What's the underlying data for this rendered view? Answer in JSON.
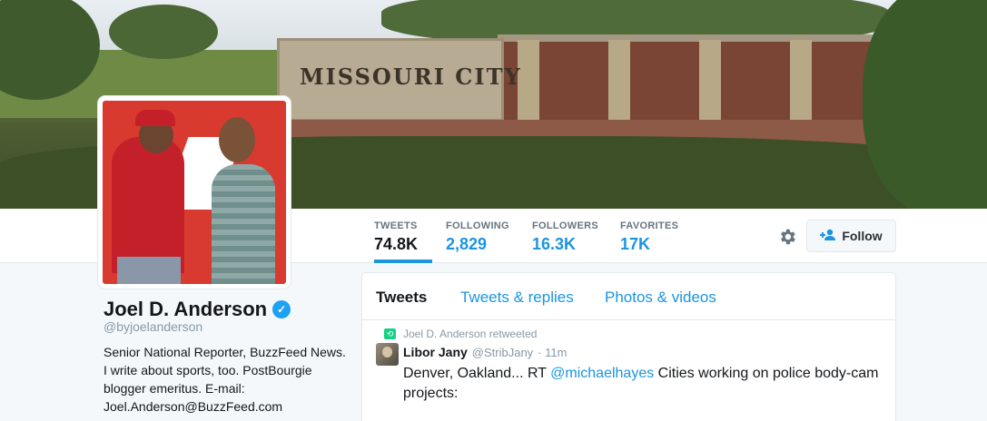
{
  "banner": {
    "sign_text": "MISSOURI CITY"
  },
  "nav": {
    "stats": [
      {
        "label": "TWEETS",
        "value": "74.8K"
      },
      {
        "label": "FOLLOWING",
        "value": "2,829"
      },
      {
        "label": "FOLLOWERS",
        "value": "16.3K"
      },
      {
        "label": "FAVORITES",
        "value": "17K"
      }
    ],
    "follow_label": "Follow"
  },
  "profile": {
    "name": "Joel D. Anderson",
    "handle": "@byjoelanderson",
    "bio": "Senior National Reporter, BuzzFeed News. I write about sports, too. PostBourgie blogger emeritus. E-mail: Joel.Anderson@BuzzFeed.com"
  },
  "timeline": {
    "tabs": [
      "Tweets",
      "Tweets & replies",
      "Photos & videos"
    ],
    "tweet": {
      "retweet_context": "Joel D. Anderson retweeted",
      "author_name": "Libor Jany",
      "author_handle": "@StribJany",
      "time": "· 11m",
      "text_before": "Denver, Oakland... RT ",
      "mention": "@michaelhayes",
      "text_after": " Cities working on police body-cam projects:"
    }
  },
  "colors": {
    "link": "#1b95e0",
    "verified": "#1da1f2",
    "retweet": "#19cf86"
  }
}
